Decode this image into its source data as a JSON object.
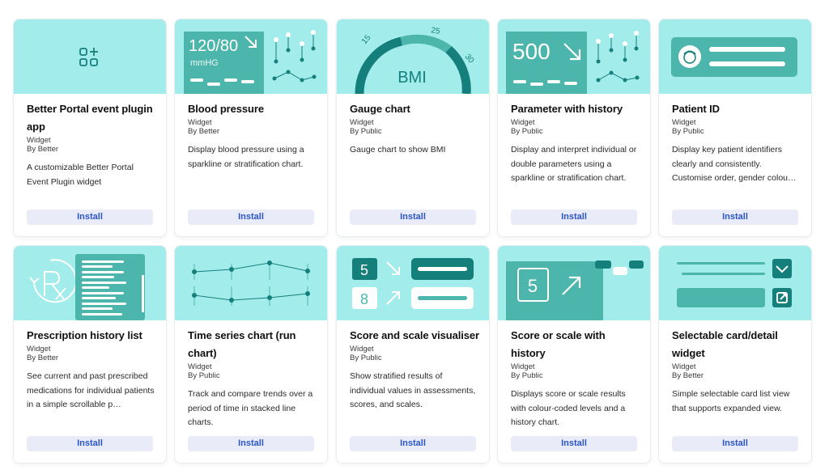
{
  "cards": [
    {
      "title": "Better Portal event plugin app",
      "type": "Widget",
      "by": "By Better",
      "description": "A customizable Better Portal Event Plugin widget",
      "install_label": "Install"
    },
    {
      "title": "Blood pressure",
      "type": "Widget",
      "by": "By Better",
      "description": "Display blood pressure using a sparkline or stratification chart.",
      "install_label": "Install",
      "thumb_value": "120/80",
      "thumb_unit": "mmHG"
    },
    {
      "title": "Gauge chart",
      "type": "Widget",
      "by": "By Public",
      "description": "Gauge chart to show BMI",
      "install_label": "Install",
      "thumb_label": "BMI",
      "ticks": [
        "15",
        "25",
        "30"
      ]
    },
    {
      "title": "Parameter with history",
      "type": "Widget",
      "by": "By Public",
      "description": "Display and interpret individual or double parameters using a sparkline or stratification chart.",
      "install_label": "Install",
      "thumb_value": "500"
    },
    {
      "title": "Patient ID",
      "type": "Widget",
      "by": "By Public",
      "description": "Display key patient identifiers clearly and consistently. Customise order, gender colou…",
      "install_label": "Install"
    },
    {
      "title": "Prescription history list",
      "type": "Widget",
      "by": "By Better",
      "description": "See current and past prescribed medications for individual patients in a simple scrollable p…",
      "install_label": "Install"
    },
    {
      "title": "Time series chart (run chart)",
      "type": "Widget",
      "by": "By Public",
      "description": "Track and compare trends over a period of time in stacked line charts.",
      "install_label": "Install"
    },
    {
      "title": "Score and scale visualiser",
      "type": "Widget",
      "by": "By Public",
      "description": "Show stratified results of individual values in assessments, scores, and scales.",
      "install_label": "Install",
      "thumb_values": [
        "5",
        "8"
      ]
    },
    {
      "title": "Score or scale with history",
      "type": "Widget",
      "by": "By Public",
      "description": "Displays score or scale results with colour-coded levels and a history chart.",
      "install_label": "Install",
      "thumb_value": "5"
    },
    {
      "title": "Selectable card/detail widget",
      "type": "Widget",
      "by": "By Better",
      "description": "Simple selectable card list view that supports expanded view.",
      "install_label": "Install"
    }
  ]
}
